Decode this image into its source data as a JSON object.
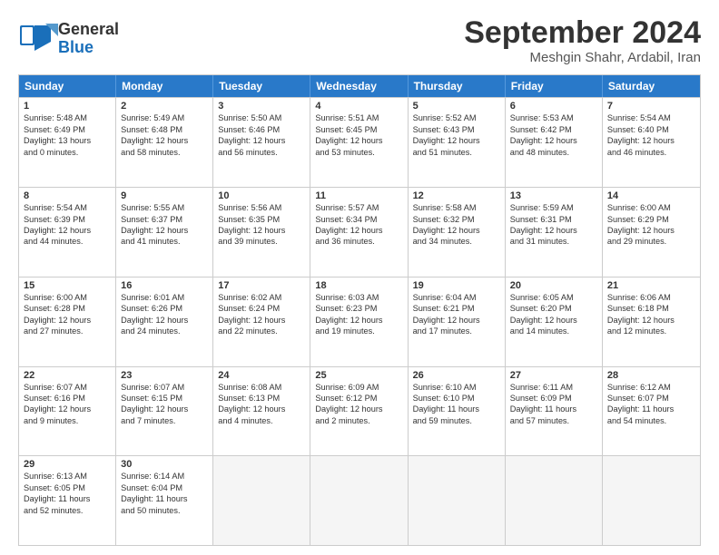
{
  "header": {
    "logo_general": "General",
    "logo_blue": "Blue",
    "main_title": "September 2024",
    "sub_title": "Meshgin Shahr, Ardabil, Iran"
  },
  "weekdays": [
    "Sunday",
    "Monday",
    "Tuesday",
    "Wednesday",
    "Thursday",
    "Friday",
    "Saturday"
  ],
  "weeks": [
    [
      {
        "day": "1",
        "lines": [
          "Sunrise: 5:48 AM",
          "Sunset: 6:49 PM",
          "Daylight: 13 hours",
          "and 0 minutes."
        ]
      },
      {
        "day": "2",
        "lines": [
          "Sunrise: 5:49 AM",
          "Sunset: 6:48 PM",
          "Daylight: 12 hours",
          "and 58 minutes."
        ]
      },
      {
        "day": "3",
        "lines": [
          "Sunrise: 5:50 AM",
          "Sunset: 6:46 PM",
          "Daylight: 12 hours",
          "and 56 minutes."
        ]
      },
      {
        "day": "4",
        "lines": [
          "Sunrise: 5:51 AM",
          "Sunset: 6:45 PM",
          "Daylight: 12 hours",
          "and 53 minutes."
        ]
      },
      {
        "day": "5",
        "lines": [
          "Sunrise: 5:52 AM",
          "Sunset: 6:43 PM",
          "Daylight: 12 hours",
          "and 51 minutes."
        ]
      },
      {
        "day": "6",
        "lines": [
          "Sunrise: 5:53 AM",
          "Sunset: 6:42 PM",
          "Daylight: 12 hours",
          "and 48 minutes."
        ]
      },
      {
        "day": "7",
        "lines": [
          "Sunrise: 5:54 AM",
          "Sunset: 6:40 PM",
          "Daylight: 12 hours",
          "and 46 minutes."
        ]
      }
    ],
    [
      {
        "day": "8",
        "lines": [
          "Sunrise: 5:54 AM",
          "Sunset: 6:39 PM",
          "Daylight: 12 hours",
          "and 44 minutes."
        ]
      },
      {
        "day": "9",
        "lines": [
          "Sunrise: 5:55 AM",
          "Sunset: 6:37 PM",
          "Daylight: 12 hours",
          "and 41 minutes."
        ]
      },
      {
        "day": "10",
        "lines": [
          "Sunrise: 5:56 AM",
          "Sunset: 6:35 PM",
          "Daylight: 12 hours",
          "and 39 minutes."
        ]
      },
      {
        "day": "11",
        "lines": [
          "Sunrise: 5:57 AM",
          "Sunset: 6:34 PM",
          "Daylight: 12 hours",
          "and 36 minutes."
        ]
      },
      {
        "day": "12",
        "lines": [
          "Sunrise: 5:58 AM",
          "Sunset: 6:32 PM",
          "Daylight: 12 hours",
          "and 34 minutes."
        ]
      },
      {
        "day": "13",
        "lines": [
          "Sunrise: 5:59 AM",
          "Sunset: 6:31 PM",
          "Daylight: 12 hours",
          "and 31 minutes."
        ]
      },
      {
        "day": "14",
        "lines": [
          "Sunrise: 6:00 AM",
          "Sunset: 6:29 PM",
          "Daylight: 12 hours",
          "and 29 minutes."
        ]
      }
    ],
    [
      {
        "day": "15",
        "lines": [
          "Sunrise: 6:00 AM",
          "Sunset: 6:28 PM",
          "Daylight: 12 hours",
          "and 27 minutes."
        ]
      },
      {
        "day": "16",
        "lines": [
          "Sunrise: 6:01 AM",
          "Sunset: 6:26 PM",
          "Daylight: 12 hours",
          "and 24 minutes."
        ]
      },
      {
        "day": "17",
        "lines": [
          "Sunrise: 6:02 AM",
          "Sunset: 6:24 PM",
          "Daylight: 12 hours",
          "and 22 minutes."
        ]
      },
      {
        "day": "18",
        "lines": [
          "Sunrise: 6:03 AM",
          "Sunset: 6:23 PM",
          "Daylight: 12 hours",
          "and 19 minutes."
        ]
      },
      {
        "day": "19",
        "lines": [
          "Sunrise: 6:04 AM",
          "Sunset: 6:21 PM",
          "Daylight: 12 hours",
          "and 17 minutes."
        ]
      },
      {
        "day": "20",
        "lines": [
          "Sunrise: 6:05 AM",
          "Sunset: 6:20 PM",
          "Daylight: 12 hours",
          "and 14 minutes."
        ]
      },
      {
        "day": "21",
        "lines": [
          "Sunrise: 6:06 AM",
          "Sunset: 6:18 PM",
          "Daylight: 12 hours",
          "and 12 minutes."
        ]
      }
    ],
    [
      {
        "day": "22",
        "lines": [
          "Sunrise: 6:07 AM",
          "Sunset: 6:16 PM",
          "Daylight: 12 hours",
          "and 9 minutes."
        ]
      },
      {
        "day": "23",
        "lines": [
          "Sunrise: 6:07 AM",
          "Sunset: 6:15 PM",
          "Daylight: 12 hours",
          "and 7 minutes."
        ]
      },
      {
        "day": "24",
        "lines": [
          "Sunrise: 6:08 AM",
          "Sunset: 6:13 PM",
          "Daylight: 12 hours",
          "and 4 minutes."
        ]
      },
      {
        "day": "25",
        "lines": [
          "Sunrise: 6:09 AM",
          "Sunset: 6:12 PM",
          "Daylight: 12 hours",
          "and 2 minutes."
        ]
      },
      {
        "day": "26",
        "lines": [
          "Sunrise: 6:10 AM",
          "Sunset: 6:10 PM",
          "Daylight: 11 hours",
          "and 59 minutes."
        ]
      },
      {
        "day": "27",
        "lines": [
          "Sunrise: 6:11 AM",
          "Sunset: 6:09 PM",
          "Daylight: 11 hours",
          "and 57 minutes."
        ]
      },
      {
        "day": "28",
        "lines": [
          "Sunrise: 6:12 AM",
          "Sunset: 6:07 PM",
          "Daylight: 11 hours",
          "and 54 minutes."
        ]
      }
    ],
    [
      {
        "day": "29",
        "lines": [
          "Sunrise: 6:13 AM",
          "Sunset: 6:05 PM",
          "Daylight: 11 hours",
          "and 52 minutes."
        ]
      },
      {
        "day": "30",
        "lines": [
          "Sunrise: 6:14 AM",
          "Sunset: 6:04 PM",
          "Daylight: 11 hours",
          "and 50 minutes."
        ]
      },
      {
        "day": "",
        "lines": []
      },
      {
        "day": "",
        "lines": []
      },
      {
        "day": "",
        "lines": []
      },
      {
        "day": "",
        "lines": []
      },
      {
        "day": "",
        "lines": []
      }
    ]
  ]
}
